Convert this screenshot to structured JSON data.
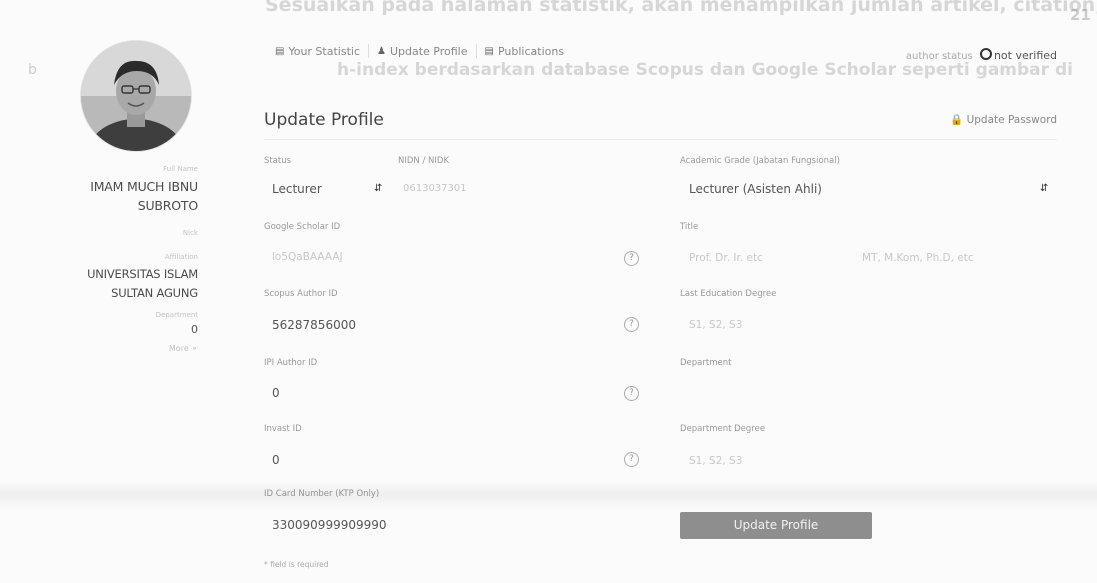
{
  "document": {
    "line1": "Sesuaikan pada halaman statistik, akan menampilkan jumlah artikel, citation, h-index",
    "line2": "h-index berdasarkan database Scopus dan Google Scholar seperti gambar di",
    "page_number": "21",
    "margin_mark": "b"
  },
  "profile": {
    "fullname_label": "Full Name",
    "name_line1": "IMAM MUCH IBNU",
    "name_line2": "SUBROTO",
    "nick_label": "Nick",
    "affiliation_label": "Affiliation",
    "affiliation_line1": "UNIVERSITAS ISLAM",
    "affiliation_line2": "SULTAN AGUNG",
    "department_label": "Department",
    "department_value": "0",
    "more_label": "More"
  },
  "nav": {
    "statistic": "Your Statistic",
    "update_profile": "Update Profile",
    "publications": "Publications",
    "author_status_label": "author status",
    "author_status_value": "not verified"
  },
  "form": {
    "title": "Update Profile",
    "update_password": "Update Password",
    "status_label": "Status",
    "status_value": "Lecturer",
    "nidn_label": "NIDN / NIDK",
    "nidn_value": "0613037301",
    "academic_label": "Academic Grade (Jabatan Fungsional)",
    "academic_value": "Lecturer (Asisten Ahli)",
    "scholar_label": "Google Scholar ID",
    "scholar_value": "lo5QaBAAAAJ",
    "title_label": "Title",
    "title_front_placeholder": "Prof. Dr. Ir. etc",
    "title_back_placeholder": "MT, M.Kom, Ph.D, etc",
    "scopus_label": "Scopus Author ID",
    "scopus_value": "56287856000",
    "last_degree_label": "Last Education Degree",
    "last_degree_placeholder": "S1, S2, S3",
    "ipi_label": "IPI Author ID",
    "ipi_value": "0",
    "department_label": "Department",
    "department_value": "",
    "invast_label": "Invast ID",
    "invast_value": "0",
    "dept_degree_label": "Department Degree",
    "dept_degree_placeholder": "S1, S2, S3",
    "ktp_label": "ID Card Number (KTP Only)",
    "ktp_value": "330090999909990",
    "submit_label": "Update Profile",
    "required_note": "* field is required",
    "help_glyph": "?"
  }
}
